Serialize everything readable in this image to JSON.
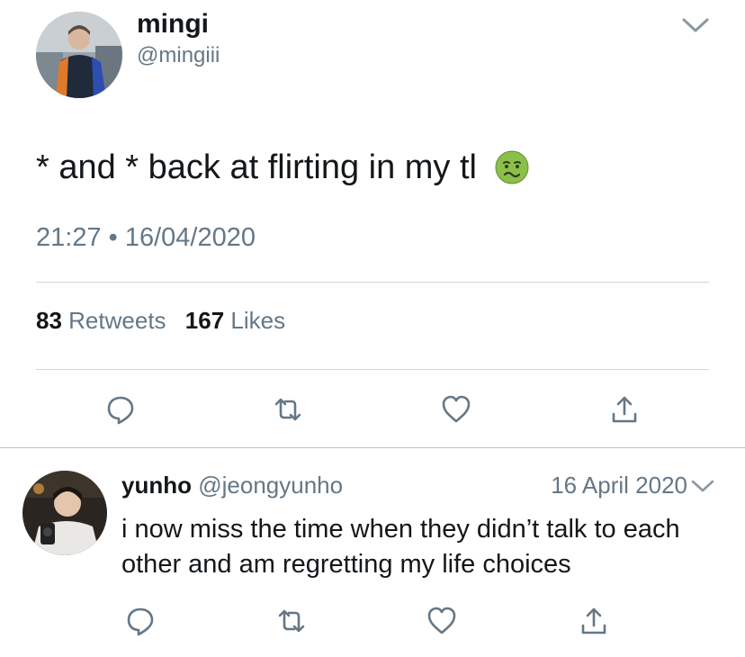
{
  "main_tweet": {
    "display_name": "mingi",
    "handle": "@mingiii",
    "text": "* and * back at flirting in my tl",
    "emoji_icon": "nauseated-face-emoji",
    "timestamp": "21:27 • 16/04/2020",
    "retweet_count": "83",
    "retweet_label": "Retweets",
    "like_count": "167",
    "like_label": "Likes",
    "actions": [
      "reply-icon",
      "retweet-icon",
      "like-icon",
      "share-icon"
    ]
  },
  "reply_tweet": {
    "display_name": "yunho",
    "handle": "@jeongyunho",
    "date": "16 April 2020",
    "text": "i now miss the time when they didn’t talk to each other and am regretting my life choices",
    "actions": [
      "reply-icon",
      "retweet-icon",
      "like-icon",
      "share-icon"
    ]
  },
  "colors": {
    "text_primary": "#14171a",
    "text_secondary": "#657786",
    "divider": "#ccd6dd",
    "icon": "#657786"
  }
}
